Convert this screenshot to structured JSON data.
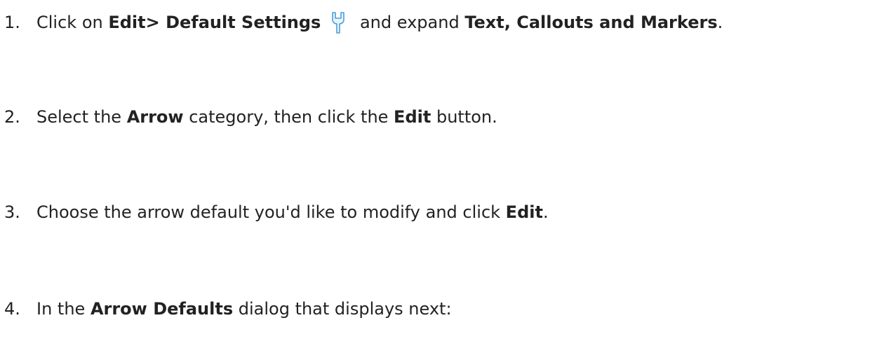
{
  "steps": [
    {
      "number": "1.",
      "t1": "Click on ",
      "b1": "Edit> Default Settings",
      "icon": "wrench-settings-icon",
      "t2": " and expand ",
      "b2": "Text, Callouts and Markers",
      "t3": "."
    },
    {
      "number": "2.",
      "t1": "Select the ",
      "b1": "Arrow",
      "t2": " category, then click the ",
      "b2": "Edit",
      "t3": " button."
    },
    {
      "number": "3.",
      "t1": "Choose the arrow default you'd like to modify and click ",
      "b1": "Edit",
      "t2": "."
    },
    {
      "number": "4.",
      "t1": "In the ",
      "b1": "Arrow Defaults",
      "t2": " dialog that displays next:"
    }
  ],
  "colors": {
    "text": "#222222",
    "icon_stroke": "#4a9fd6",
    "icon_fill": "#e8f4fc"
  }
}
